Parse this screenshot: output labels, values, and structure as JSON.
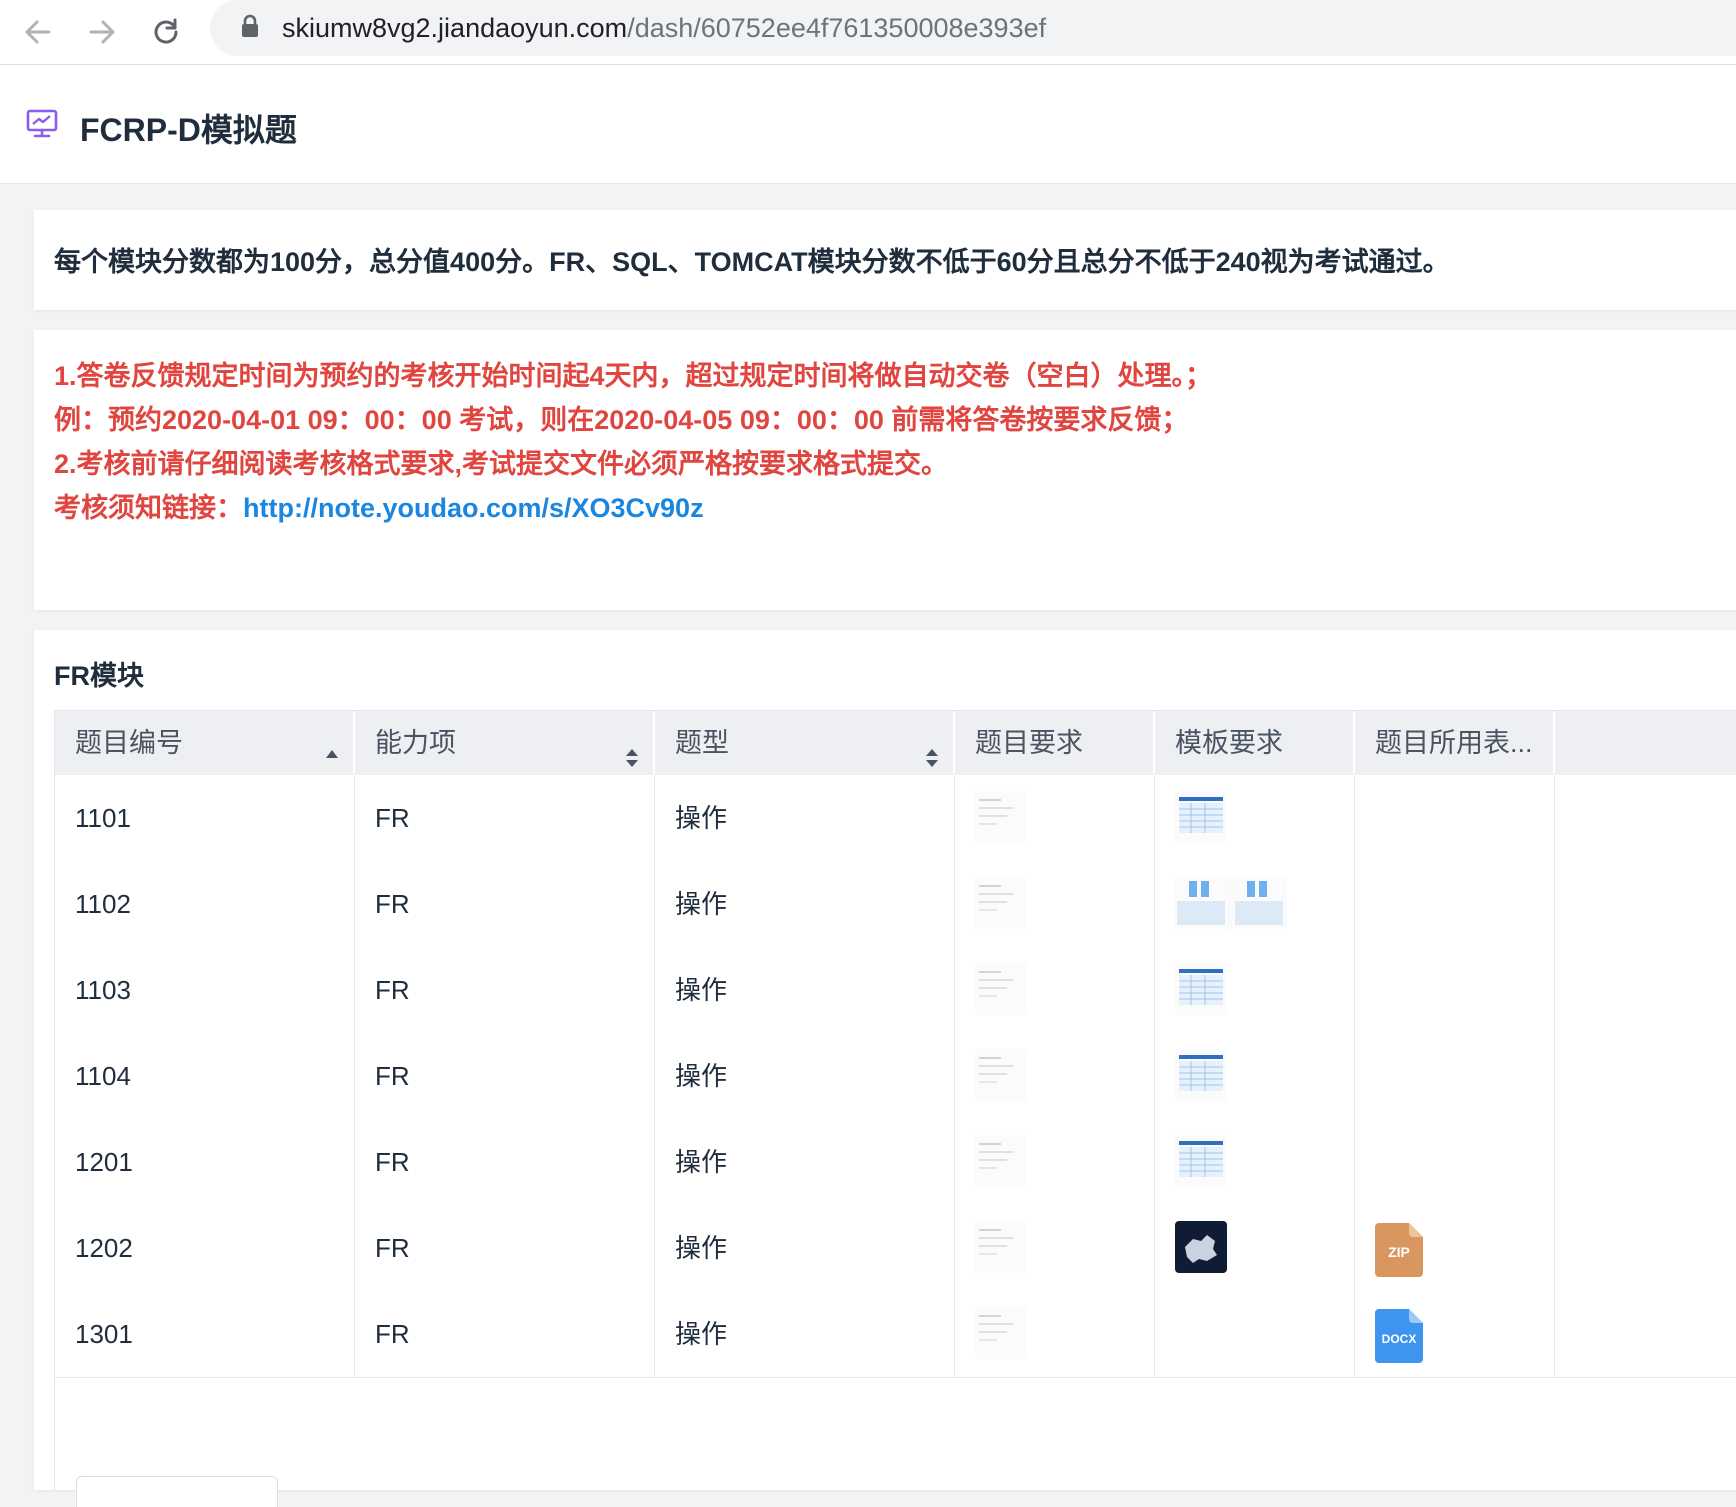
{
  "browser": {
    "url_host": "skiumw8vg2.jiandaoyun.com",
    "url_path": "/dash/60752ee4f761350008e393ef"
  },
  "app": {
    "title": "FCRP-D模拟题"
  },
  "notice": {
    "text": "每个模块分数都为100分，总分值400分。FR、SQL、TOMCAT模块分数不低于60分且总分不低于240视为考试通过。"
  },
  "rules": {
    "line1": "1.答卷反馈规定时间为预约的考核开始时间起4天内，超过规定时间将做自动交卷（空白）处理。；",
    "line2": "例：预约2020-04-01 09：00：00 考试，则在2020-04-05 09：00：00 前需将答卷按要求反馈；",
    "line3": "2.考核前请仔细阅读考核格式要求,考试提交文件必须严格按要求格式提交。",
    "line4_prefix": "考核须知链接：",
    "line4_link": "http://note.youdao.com/s/XO3Cv90z"
  },
  "module": {
    "title": "FR模块",
    "columns": [
      "题目编号",
      "能力项",
      "题型",
      "题目要求",
      "模板要求",
      "题目所用表..."
    ],
    "rows": [
      {
        "id": "1101",
        "ability": "FR",
        "type": "操作",
        "req_thumb": true,
        "tpl_thumb": "table",
        "file": ""
      },
      {
        "id": "1102",
        "ability": "FR",
        "type": "操作",
        "req_thumb": true,
        "tpl_thumb": "dual",
        "file": ""
      },
      {
        "id": "1103",
        "ability": "FR",
        "type": "操作",
        "req_thumb": true,
        "tpl_thumb": "table",
        "file": ""
      },
      {
        "id": "1104",
        "ability": "FR",
        "type": "操作",
        "req_thumb": true,
        "tpl_thumb": "table",
        "file": ""
      },
      {
        "id": "1201",
        "ability": "FR",
        "type": "操作",
        "req_thumb": true,
        "tpl_thumb": "table",
        "file": ""
      },
      {
        "id": "1202",
        "ability": "FR",
        "type": "操作",
        "req_thumb": true,
        "tpl_thumb": "map",
        "file": "ZIP"
      },
      {
        "id": "1301",
        "ability": "FR",
        "type": "操作",
        "req_thumb": true,
        "tpl_thumb": "",
        "file": "DOCX"
      }
    ]
  },
  "colors": {
    "accent": "#1a86e0",
    "warning_text": "#e0463f",
    "zip_icon": "#d9975f",
    "docx_icon": "#3d95f0",
    "dash_icon": "#8a5cf0"
  },
  "icons": {
    "back": "arrow-left-icon",
    "forward": "arrow-right-icon",
    "reload": "reload-icon",
    "lock": "lock-icon",
    "dashboard": "dashboard-icon"
  }
}
